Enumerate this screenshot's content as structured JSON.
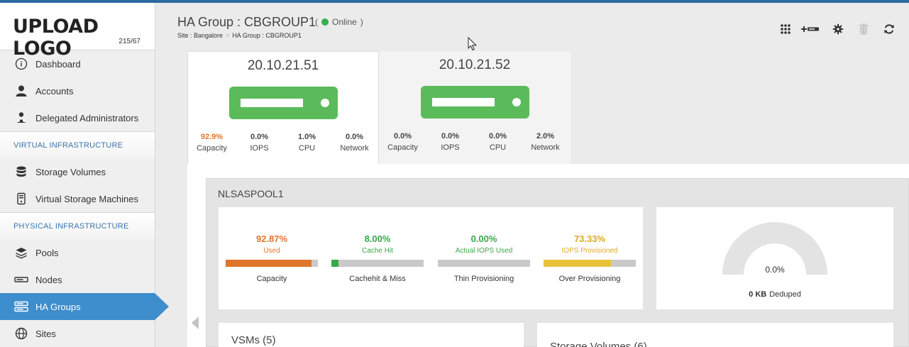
{
  "logo": {
    "text": "UPLOAD LOGO",
    "sub": "215/67"
  },
  "sidebar": {
    "items_top": [
      {
        "label": "Dashboard",
        "icon": "info-icon"
      },
      {
        "label": "Accounts",
        "icon": "user-icon"
      },
      {
        "label": "Delegated Administrators",
        "icon": "delegated-admin-icon"
      }
    ],
    "section_virtual": "VIRTUAL INFRASTRUCTURE",
    "items_virtual": [
      {
        "label": "Storage Volumes",
        "icon": "database-icon"
      },
      {
        "label": "Virtual Storage Machines",
        "icon": "vsm-icon"
      }
    ],
    "section_physical": "PHYSICAL INFRASTRUCTURE",
    "items_physical": [
      {
        "label": "Pools",
        "icon": "layers-icon"
      },
      {
        "label": "Nodes",
        "icon": "node-icon"
      },
      {
        "label": "HA Groups",
        "icon": "ha-group-icon",
        "active": true
      },
      {
        "label": "Sites",
        "icon": "globe-icon"
      }
    ]
  },
  "header": {
    "title": "HA Group : CBGROUP1",
    "status_open": "(",
    "status": "Online",
    "status_close": ")",
    "status_color": "#2fb24a",
    "breadcrumb": [
      "Site : Bangalore",
      "HA Group : CBGROUP1"
    ],
    "toolbar": [
      "grid-icon",
      "add-node-icon",
      "gear-icon",
      "trash-icon",
      "refresh-icon"
    ]
  },
  "nodes": [
    {
      "ip": "20.10.21.51",
      "stats": [
        {
          "value": "92.9%",
          "label": "Capacity"
        },
        {
          "value": "0.0%",
          "label": "IOPS"
        },
        {
          "value": "1.0%",
          "label": "CPU"
        },
        {
          "value": "0.0%",
          "label": "Network"
        }
      ]
    },
    {
      "ip": "20.10.21.52",
      "stats": [
        {
          "value": "0.0%",
          "label": "Capacity"
        },
        {
          "value": "0.0%",
          "label": "IOPS"
        },
        {
          "value": "0.0%",
          "label": "CPU"
        },
        {
          "value": "2.0%",
          "label": "Network"
        }
      ]
    }
  ],
  "pool": {
    "name": "NLSASPOOL1",
    "metrics": [
      {
        "pct": "92.87%",
        "sub": "Used",
        "caption": "Capacity",
        "fraction": 0.9287,
        "color": "#e0762a"
      },
      {
        "pct": "8.00%",
        "sub": "Cache Hit",
        "caption": "Cachehit & Miss",
        "fraction": 0.08,
        "color": "#3aa84a"
      },
      {
        "pct": "0.00%",
        "sub": "Actual IOPS Used",
        "caption": "Thin Provisioning",
        "fraction": 0.0,
        "color": "#3aa84a"
      },
      {
        "pct": "73.33%",
        "sub": "IOPS Provisioned",
        "caption": "Over Provisioning",
        "fraction": 0.7333,
        "color": "#e8c23a"
      }
    ],
    "dedupe": {
      "value": "0.0%",
      "amount": "0 KB",
      "label": "Deduped"
    }
  },
  "vsms": {
    "title": "VSMs (5)"
  },
  "storage_volumes": {
    "title": "Storage Volumes (6)"
  }
}
